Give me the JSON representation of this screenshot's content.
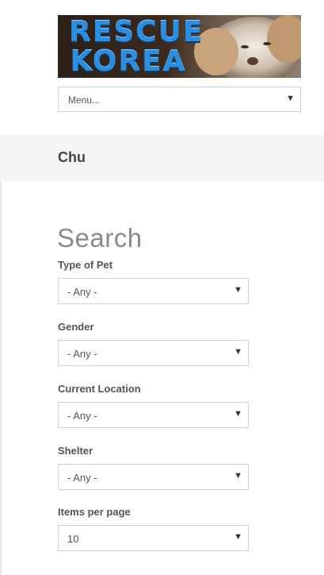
{
  "site": {
    "logo_text": "RESCUE\nKOREA",
    "logo_alt": "dog-photo"
  },
  "nav": {
    "menu_label": "Menu..."
  },
  "page": {
    "title": "Chu"
  },
  "search": {
    "heading": "Search",
    "filters": [
      {
        "label": "Type of Pet",
        "value": "- Any -"
      },
      {
        "label": "Gender",
        "value": "- Any -"
      },
      {
        "label": "Current Location",
        "value": "- Any -"
      },
      {
        "label": "Shelter",
        "value": "- Any -"
      },
      {
        "label": "Items per page",
        "value": "10"
      }
    ]
  },
  "icons": {
    "dropdown": "chevron-down-icon"
  },
  "colors": {
    "logo_text": "#2a8fe0",
    "title_bar_bg": "#f5f5f5"
  }
}
